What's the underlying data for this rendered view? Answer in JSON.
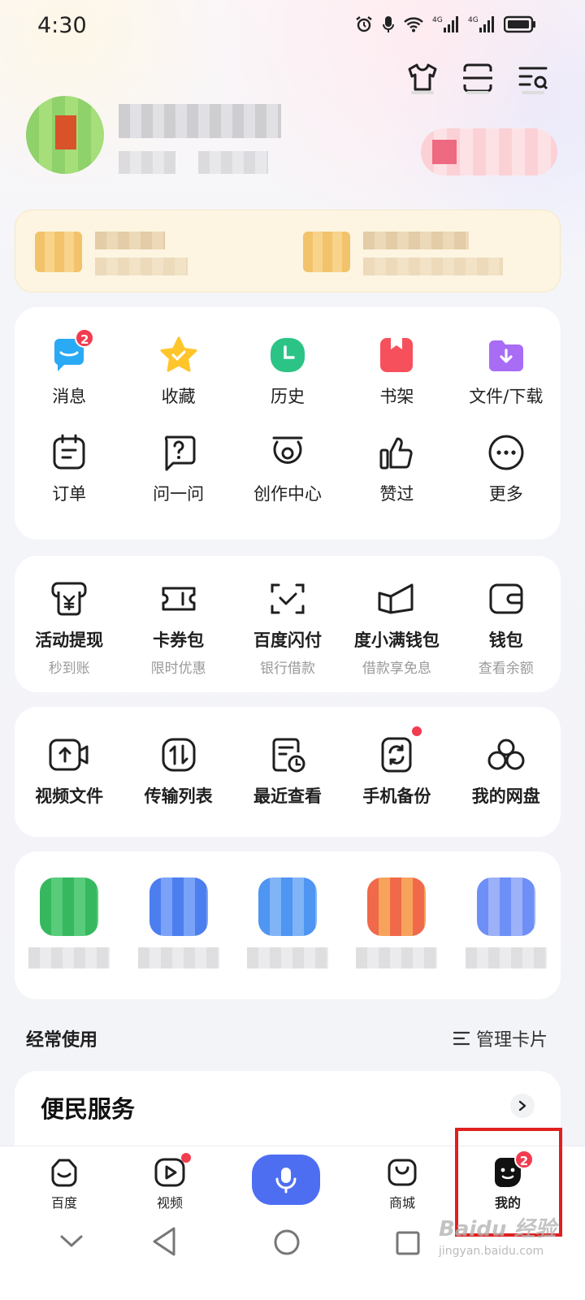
{
  "status_bar": {
    "time": "4:30"
  },
  "quick_grid": {
    "items": [
      {
        "label": "消息",
        "icon": "message-icon",
        "badge": "2"
      },
      {
        "label": "收藏",
        "icon": "star-icon"
      },
      {
        "label": "历史",
        "icon": "history-clock-icon"
      },
      {
        "label": "书架",
        "icon": "bookshelf-icon"
      },
      {
        "label": "文件/下载",
        "icon": "download-folder-icon"
      },
      {
        "label": "订单",
        "icon": "order-icon"
      },
      {
        "label": "问一问",
        "icon": "question-icon"
      },
      {
        "label": "创作中心",
        "icon": "creation-icon"
      },
      {
        "label": "赞过",
        "icon": "thumbs-up-icon"
      },
      {
        "label": "更多",
        "icon": "more-icon"
      }
    ]
  },
  "finance": {
    "items": [
      {
        "label": "活动提现",
        "sub": "秒到账",
        "icon": "withdraw-yen-icon"
      },
      {
        "label": "卡券包",
        "sub": "限时优惠",
        "icon": "coupon-icon"
      },
      {
        "label": "百度闪付",
        "sub": "银行借款",
        "icon": "flash-pay-icon"
      },
      {
        "label": "度小满钱包",
        "sub": "借款享免息",
        "icon": "duxiaoman-icon"
      },
      {
        "label": "钱包",
        "sub": "查看余额",
        "icon": "wallet-icon"
      }
    ]
  },
  "netdisk": {
    "items": [
      {
        "label": "视频文件",
        "icon": "video-file-icon"
      },
      {
        "label": "传输列表",
        "icon": "transfer-icon"
      },
      {
        "label": "最近查看",
        "icon": "recent-icon"
      },
      {
        "label": "手机备份",
        "icon": "phone-backup-icon",
        "dot": true
      },
      {
        "label": "我的网盘",
        "icon": "netdisk-icon"
      }
    ]
  },
  "frequent": {
    "title": "经常使用",
    "manage": "管理卡片"
  },
  "service": {
    "title": "便民服务"
  },
  "tabbar": {
    "tabs": [
      {
        "label": "百度",
        "icon": "baidu-home-icon"
      },
      {
        "label": "视频",
        "icon": "video-tab-icon",
        "dot": true
      },
      {
        "label": "",
        "icon": "mic-icon"
      },
      {
        "label": "商城",
        "icon": "mall-bag-icon"
      },
      {
        "label": "我的",
        "icon": "profile-face-icon",
        "badge": "2"
      }
    ]
  },
  "colors": {
    "accent": "#4e6ef2",
    "badge": "#f23c4f",
    "highlight": "#e02020"
  },
  "watermark": {
    "brand": "Baidu 经验",
    "url": "jingyan.baidu.com"
  }
}
